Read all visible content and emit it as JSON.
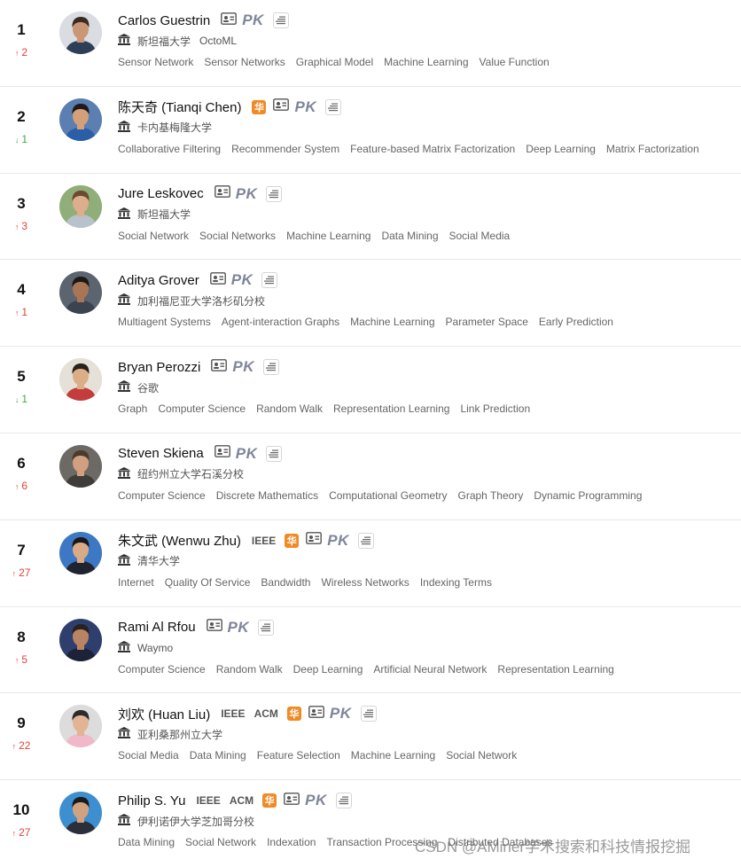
{
  "watermark": "CSDN @AMiner学术搜索和科技情报挖掘",
  "pk_label": "PK",
  "hua_glyph": "华",
  "colors": {
    "up": "#e0433a",
    "down": "#3daa4a",
    "hua": "#f08a24",
    "pk": "#7f869a"
  },
  "icons": {
    "profile": "id-card-icon",
    "compare": "pk-badge",
    "list": "list-icon",
    "institution": "bank-icon"
  },
  "scholars": [
    {
      "rank": "1",
      "trend": "2",
      "dir": "up",
      "name": "Carlos Guestrin",
      "tags": [],
      "hua": false,
      "inst": [
        "斯坦福大学",
        "OctoML"
      ],
      "keywords": [
        "Sensor Network",
        "Sensor Networks",
        "Graphical Model",
        "Machine Learning",
        "Value Function"
      ],
      "avatar": {
        "bg": "#d9dde2",
        "skin": "#c99677",
        "hair": "#3a2a22",
        "shirt": "#2f3e57"
      }
    },
    {
      "rank": "2",
      "trend": "1",
      "dir": "down",
      "name": "陈天奇 (Tianqi Chen)",
      "tags": [],
      "hua": true,
      "inst": [
        "卡内基梅隆大学"
      ],
      "keywords": [
        "Collaborative Filtering",
        "Recommender System",
        "Feature-based Matrix Factorization",
        "Deep Learning",
        "Matrix Factorization"
      ],
      "avatar": {
        "bg": "#5a7fb0",
        "skin": "#d4a07a",
        "hair": "#1e1a18",
        "shirt": "#2a5fa8"
      }
    },
    {
      "rank": "3",
      "trend": "3",
      "dir": "up",
      "name": "Jure Leskovec",
      "tags": [],
      "hua": false,
      "inst": [
        "斯坦福大学"
      ],
      "keywords": [
        "Social Network",
        "Social Networks",
        "Machine Learning",
        "Data Mining",
        "Social Media"
      ],
      "avatar": {
        "bg": "#8fae7a",
        "skin": "#dcae8e",
        "hair": "#6b4a30",
        "shirt": "#b8c2cc"
      }
    },
    {
      "rank": "4",
      "trend": "1",
      "dir": "up",
      "name": "Aditya Grover",
      "tags": [],
      "hua": false,
      "inst": [
        "加利福尼亚大学洛杉矶分校"
      ],
      "keywords": [
        "Multiagent Systems",
        "Agent-interaction Graphs",
        "Machine Learning",
        "Parameter Space",
        "Early Prediction"
      ],
      "avatar": {
        "bg": "#5c6470",
        "skin": "#a87656",
        "hair": "#1c1816",
        "shirt": "#3b4250"
      }
    },
    {
      "rank": "5",
      "trend": "1",
      "dir": "down",
      "name": "Bryan Perozzi",
      "tags": [],
      "hua": false,
      "inst": [
        "谷歌"
      ],
      "keywords": [
        "Graph",
        "Computer Science",
        "Random Walk",
        "Representation Learning",
        "Link Prediction"
      ],
      "avatar": {
        "bg": "#e6e1d8",
        "skin": "#dcae88",
        "hair": "#2a221c",
        "shirt": "#c43c3c"
      }
    },
    {
      "rank": "6",
      "trend": "6",
      "dir": "up",
      "name": "Steven Skiena",
      "tags": [],
      "hua": false,
      "inst": [
        "纽约州立大学石溪分校"
      ],
      "keywords": [
        "Computer Science",
        "Discrete Mathematics",
        "Computational Geometry",
        "Graph Theory",
        "Dynamic Programming"
      ],
      "avatar": {
        "bg": "#6d6a66",
        "skin": "#d0a080",
        "hair": "#4b3b2e",
        "shirt": "#3f3d3a"
      }
    },
    {
      "rank": "7",
      "trend": "27",
      "dir": "up",
      "name": "朱文武 (Wenwu Zhu)",
      "tags": [
        "IEEE"
      ],
      "hua": true,
      "inst": [
        "清华大学"
      ],
      "keywords": [
        "Internet",
        "Quality Of Service",
        "Bandwidth",
        "Wireless Networks",
        "Indexing Terms"
      ],
      "avatar": {
        "bg": "#3d78c4",
        "skin": "#d8aa86",
        "hair": "#1a1818",
        "shirt": "#1f2430"
      }
    },
    {
      "rank": "8",
      "trend": "5",
      "dir": "up",
      "name": "Rami Al Rfou",
      "tags": [],
      "hua": false,
      "inst": [
        "Waymo"
      ],
      "keywords": [
        "Computer Science",
        "Random Walk",
        "Deep Learning",
        "Artificial Neural Network",
        "Representation Learning"
      ],
      "avatar": {
        "bg": "#2e3f6e",
        "skin": "#b98464",
        "hair": "#2a2220",
        "shirt": "#1d2238"
      }
    },
    {
      "rank": "9",
      "trend": "22",
      "dir": "up",
      "name": "刘欢 (Huan Liu)",
      "tags": [
        "IEEE",
        "ACM"
      ],
      "hua": true,
      "inst": [
        "亚利桑那州立大学"
      ],
      "keywords": [
        "Social Media",
        "Data Mining",
        "Feature Selection",
        "Machine Learning",
        "Social Network"
      ],
      "avatar": {
        "bg": "#dcdcdc",
        "skin": "#e0b494",
        "hair": "#2b2b2b",
        "shirt": "#f0b8c8"
      }
    },
    {
      "rank": "10",
      "trend": "27",
      "dir": "up",
      "name": "Philip S. Yu",
      "tags": [
        "IEEE",
        "ACM"
      ],
      "hua": true,
      "inst": [
        "伊利诺伊大学芝加哥分校"
      ],
      "keywords": [
        "Data Mining",
        "Social Network",
        "Indexation",
        "Transaction Processing",
        "Distributed Databases"
      ],
      "avatar": {
        "bg": "#3e8fcf",
        "skin": "#d2a27e",
        "hair": "#1c1a1a",
        "shirt": "#2a2f3a"
      }
    }
  ]
}
